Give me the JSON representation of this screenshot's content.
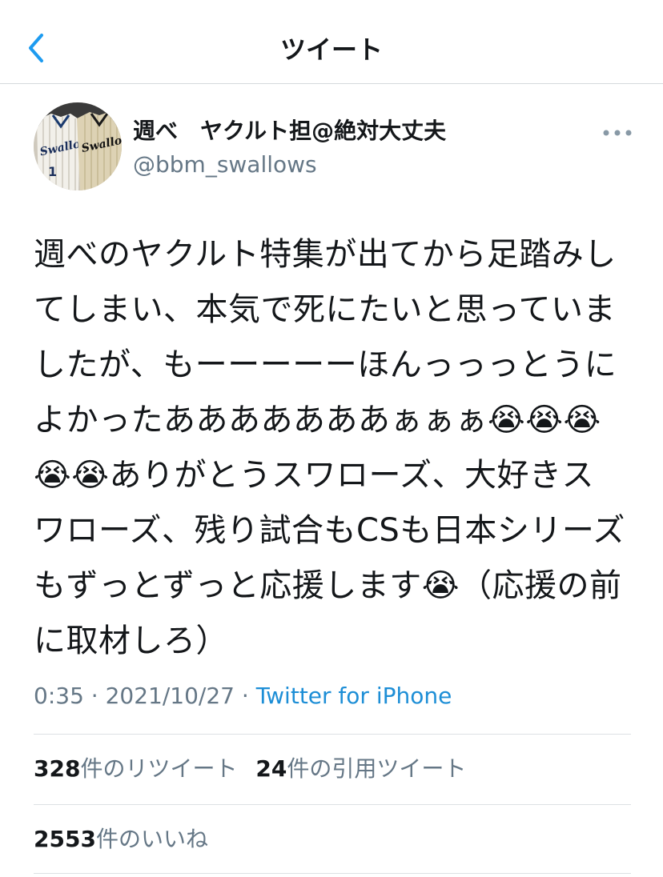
{
  "header": {
    "title": "ツイート",
    "back_icon": "chevron-left-icon",
    "accent_color": "#1d9bf0"
  },
  "author": {
    "display_name": "週べ　ヤクルト担@絶対大丈夫",
    "handle": "@bbm_swallows",
    "avatar_image": "swallows-jerseys",
    "avatar_text": [
      "Swallows",
      "Swallows"
    ],
    "avatar_number": "1",
    "more_icon": "more-horizontal-icon"
  },
  "tweet": {
    "text": "週べのヤクルト特集が出てから足踏みしてしまい、本気で死にたいと思っていましたが、もーーーーーほんっっっとうによかったあああああああぁぁぁ😭😭😭😭😭ありがとうスワローズ、大好きスワローズ、残り試合もCSも日本シリーズもずっとずっと応援します😭（応援の前に取材しろ）"
  },
  "meta": {
    "time": "0:35",
    "separator_1": " · ",
    "date": "2021/10/27",
    "separator_2": " · ",
    "source": "Twitter for iPhone"
  },
  "stats": {
    "retweets_count": "328",
    "retweets_label": "件のリツイート",
    "quotes_count": "24",
    "quotes_label": "件の引用ツイート",
    "likes_count": "2553",
    "likes_label": "件のいいね"
  }
}
